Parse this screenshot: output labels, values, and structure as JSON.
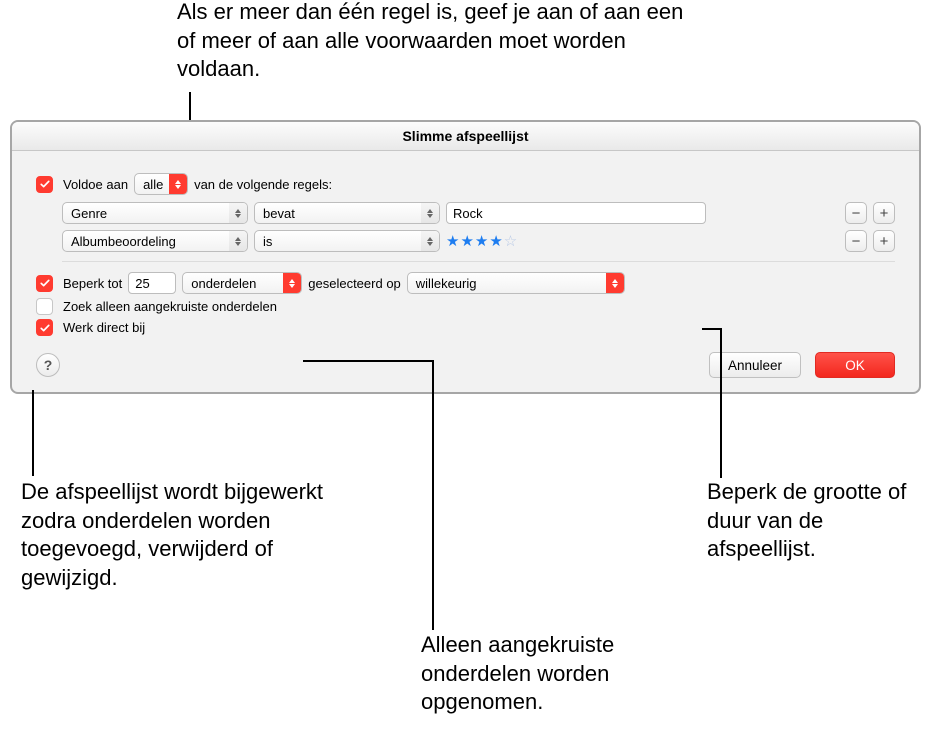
{
  "callouts": {
    "top": "Als er meer dan één regel is, geef je aan of aan een of meer of aan alle voorwaarden moet worden voldaan.",
    "left": "De afspeellijst wordt bijgewerkt zodra onderdelen worden toegevoegd, verwijderd of gewijzigd.",
    "bottomCenter": "Alleen aangekruiste onderdelen worden opgenomen.",
    "right": "Beperk de grootte of duur van de afspeellijst."
  },
  "dialog": {
    "title": "Slimme afspeellijst",
    "matchBefore": "Voldoe aan",
    "matchSelect": "alle",
    "matchAfter": "van de volgende regels:",
    "rules": [
      {
        "field": "Genre",
        "op": "bevat",
        "value": "Rock",
        "stars": null
      },
      {
        "field": "Albumbeoordeling",
        "op": "is",
        "value": "",
        "stars": 4
      }
    ],
    "limit": {
      "checked": true,
      "before": "Beperk tot",
      "countValue": "25",
      "unit": "onderdelen",
      "mid": "geselecteerd op",
      "method": "willekeurig"
    },
    "onlyChecked": {
      "checked": false,
      "label": "Zoek alleen aangekruiste onderdelen"
    },
    "liveUpdate": {
      "checked": true,
      "label": "Werk direct bij"
    },
    "help": "?",
    "cancel": "Annuleer",
    "ok": "OK"
  }
}
